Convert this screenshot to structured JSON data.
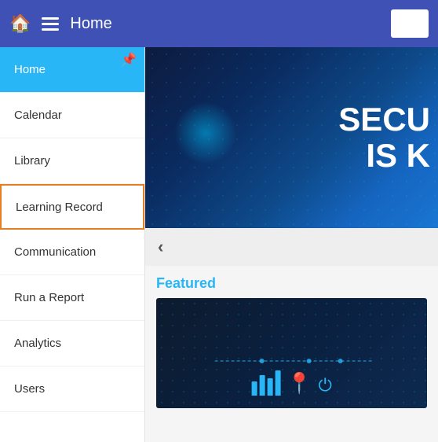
{
  "header": {
    "title": "Home",
    "icons": {
      "home": "🏠",
      "menu": "≡",
      "pin": "📌"
    }
  },
  "sidebar": {
    "items": [
      {
        "id": "home",
        "label": "Home",
        "active": true,
        "highlighted": false
      },
      {
        "id": "calendar",
        "label": "Calendar",
        "active": false,
        "highlighted": false
      },
      {
        "id": "library",
        "label": "Library",
        "active": false,
        "highlighted": false
      },
      {
        "id": "learning-record",
        "label": "Learning Record",
        "active": false,
        "highlighted": true
      },
      {
        "id": "communication",
        "label": "Communication",
        "active": false,
        "highlighted": false
      },
      {
        "id": "run-a-report",
        "label": "Run a Report",
        "active": false,
        "highlighted": false
      },
      {
        "id": "analytics",
        "label": "Analytics",
        "active": false,
        "highlighted": false
      },
      {
        "id": "users",
        "label": "Users",
        "active": false,
        "highlighted": false
      }
    ]
  },
  "hero": {
    "text_line1": "SECU",
    "text_line2": "IS K"
  },
  "navigation": {
    "back_arrow": "‹"
  },
  "featured": {
    "label": "Featured"
  }
}
